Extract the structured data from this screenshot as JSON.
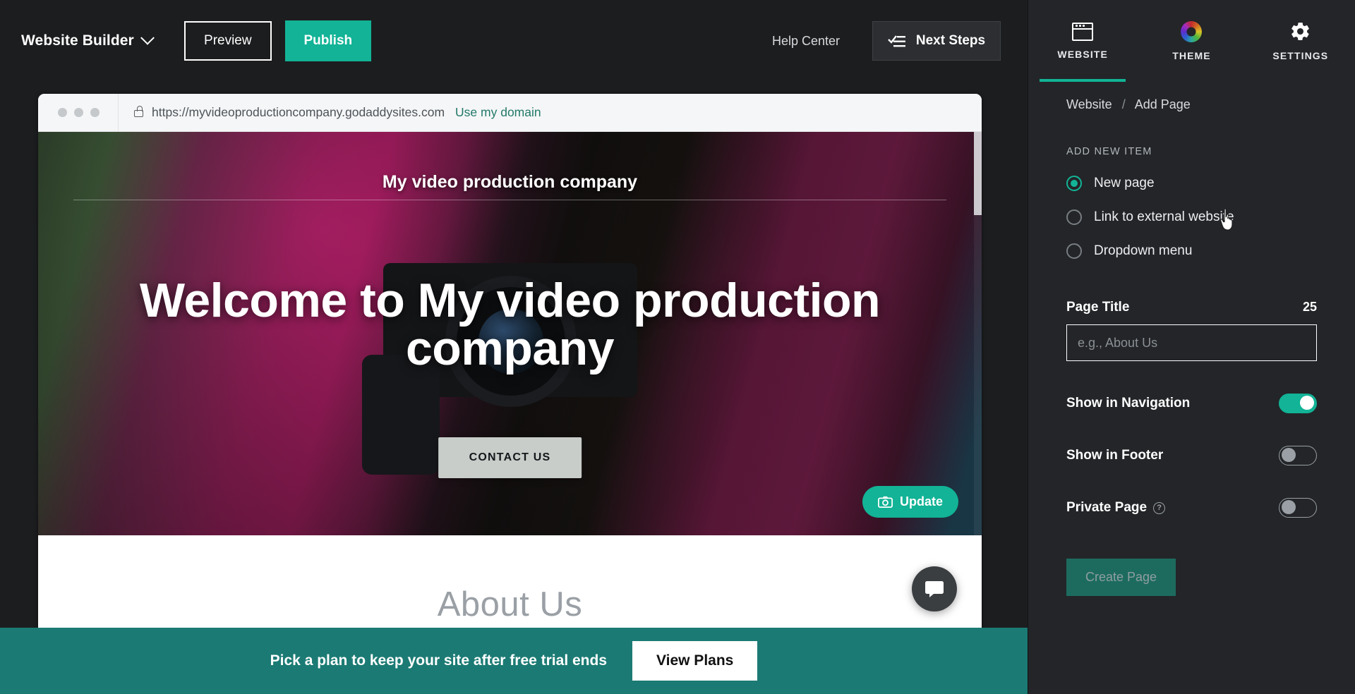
{
  "topbar": {
    "brand": "Website Builder",
    "brand_chevron_icon": "chevron-down-icon",
    "preview_label": "Preview",
    "publish_label": "Publish",
    "help_center_label": "Help Center",
    "next_steps_label": "Next Steps",
    "next_steps_icon": "checklist-icon",
    "publish_color": "#12b396"
  },
  "browser": {
    "lock_icon": "lock-icon",
    "url": "https://myvideoproductioncompany.godaddysites.com",
    "use_domain_label": "Use my domain",
    "use_domain_color": "#22796a"
  },
  "site": {
    "site_name": "My video production company",
    "hero_title": "Welcome to My video production company",
    "hero_cta_label": "CONTACT US",
    "update_label": "Update",
    "update_icon": "camera-icon",
    "about_heading": "About Us",
    "chat_icon": "chat-bubble-icon"
  },
  "banner": {
    "message": "Pick a plan to keep your site after free trial ends",
    "button_label": "View Plans",
    "background": "#1b7b74"
  },
  "panel": {
    "tabs": [
      {
        "label": "WEBSITE",
        "icon": "browser-window-icon",
        "active": true
      },
      {
        "label": "THEME",
        "icon": "color-wheel-icon",
        "active": false
      },
      {
        "label": "SETTINGS",
        "icon": "gear-icon",
        "active": false
      }
    ],
    "breadcrumb": {
      "root": "Website",
      "separator": "/",
      "current": "Add Page"
    },
    "section_label": "ADD NEW ITEM",
    "radios": [
      {
        "label": "New page",
        "selected": true
      },
      {
        "label": "Link to external website",
        "selected": false
      },
      {
        "label": "Dropdown menu",
        "selected": false
      }
    ],
    "page_title": {
      "label": "Page Title",
      "char_count": "25",
      "value": "",
      "placeholder": "e.g., About Us"
    },
    "toggles": [
      {
        "label": "Show in Navigation",
        "on": true,
        "help": false
      },
      {
        "label": "Show in Footer",
        "on": false,
        "help": false
      },
      {
        "label": "Private Page",
        "on": false,
        "help": true,
        "help_icon": "question-mark-icon"
      }
    ],
    "create_button": {
      "label": "Create Page",
      "disabled": true
    },
    "accent_color": "#12b396"
  }
}
